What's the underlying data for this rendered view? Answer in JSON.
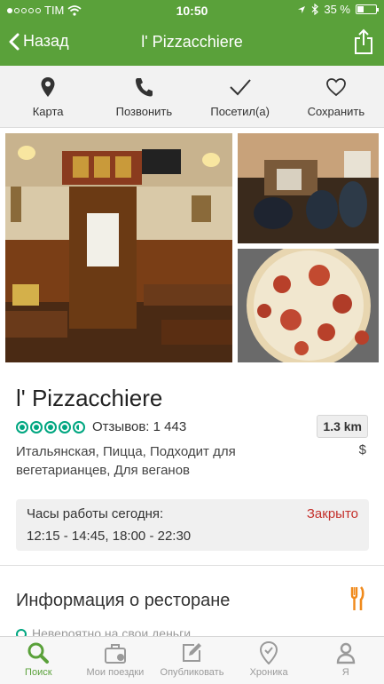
{
  "status_bar": {
    "carrier": "TIM",
    "time": "10:50",
    "battery": "35 %",
    "battery_level": 0.35
  },
  "nav": {
    "back_label": "Назад",
    "title": "l' Pizzacchiere"
  },
  "actions": [
    {
      "label": "Карта",
      "icon": "map-pin-icon"
    },
    {
      "label": "Позвонить",
      "icon": "phone-icon"
    },
    {
      "label": "Посетил(а)",
      "icon": "checkmark-icon"
    },
    {
      "label": "Сохранить",
      "icon": "heart-icon"
    }
  ],
  "restaurant": {
    "name": "l' Pizzacchiere",
    "rating_bubbles": 4.5,
    "reviews": "Отзывов: 1 443",
    "distance": "1.3 km",
    "cuisine": "Итальянская, Пицца, Подходит для вегетарианцев, Для веганов",
    "price": "$"
  },
  "hours": {
    "label": "Часы работы сегодня:",
    "status": "Закрыто",
    "times": "12:15 - 14:45, 18:00 - 22:30"
  },
  "info_section": {
    "title": "Информация о ресторане",
    "peek_text": "Невероятно на свои деньги"
  },
  "colors": {
    "brand_green": "#5aa13a",
    "rating_green": "#00a680",
    "closed_red": "#c4302b",
    "fork_orange": "#f08a1c"
  },
  "tabs": [
    {
      "label": "Поиск",
      "icon": "search-icon",
      "active": true
    },
    {
      "label": "Мои поездки",
      "icon": "suitcase-icon",
      "active": false
    },
    {
      "label": "Опубликовать",
      "icon": "compose-icon",
      "active": false
    },
    {
      "label": "Хроника",
      "icon": "location-icon",
      "active": false
    },
    {
      "label": "Я",
      "icon": "profile-icon",
      "active": false
    }
  ]
}
